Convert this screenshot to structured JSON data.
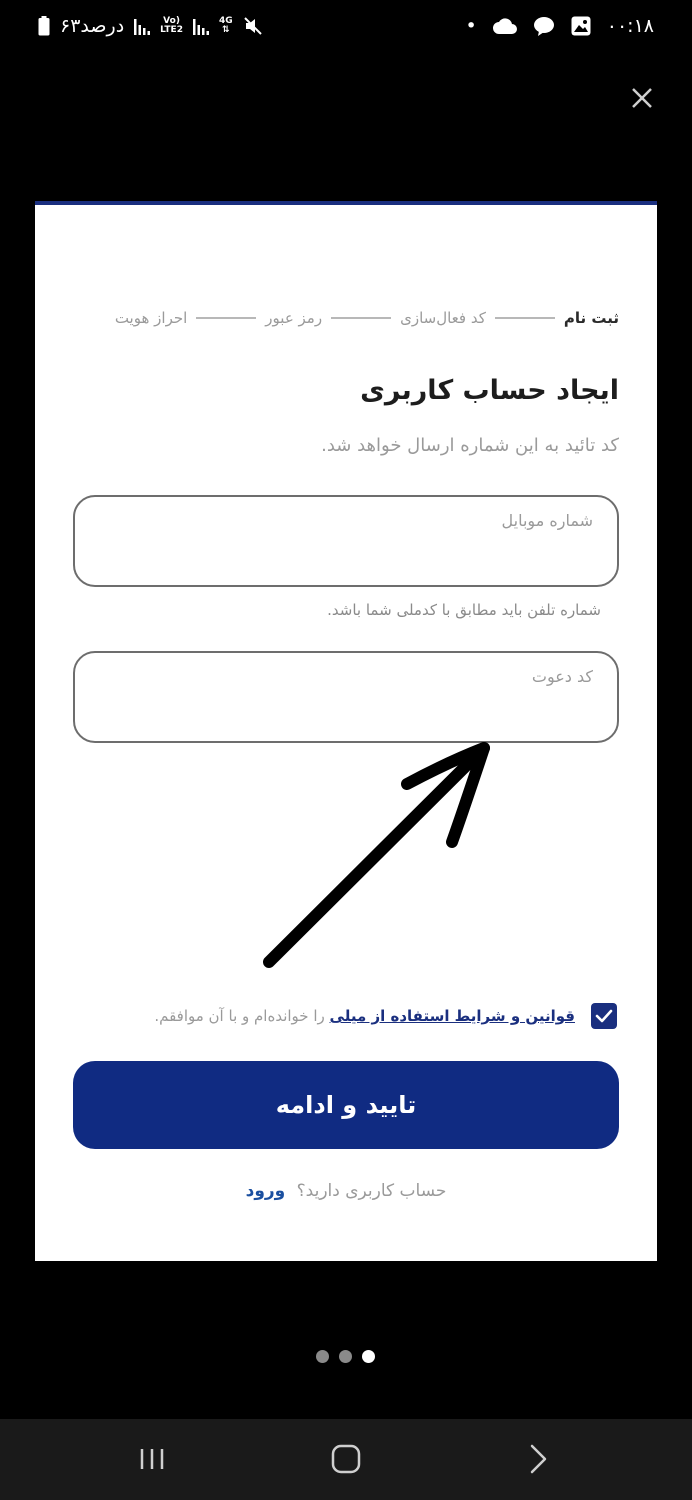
{
  "status_bar": {
    "time": "۰۰:۱۸",
    "battery_text": "۶۳درصد",
    "network_4g": "4G",
    "volte_top": "Vo)",
    "volte_bottom": "LTE2",
    "dot": "•"
  },
  "signup": {
    "steps": [
      "ثبت نام",
      "کد فعال‌سازی",
      "رمز عبور",
      "احراز هویت"
    ],
    "active_step_index": 0,
    "title": "ایجاد حساب کاربری",
    "subtitle": "کد تائید به این شماره ارسال خواهد شد.",
    "mobile_label": "شماره موبایل",
    "mobile_hint": "شماره تلفن باید مطابق با کدملی شما باشد.",
    "invite_label": "کد دعوت",
    "terms_link": "قوانین و شرایط استفاده از میلی",
    "terms_suffix": "را خوانده‌ام و با آن موافقم.",
    "terms_checked": true,
    "submit_label": "تایید و ادامه",
    "login_prompt": "حساب کاربری دارید؟",
    "login_link": "ورود"
  },
  "pager": {
    "count": 3,
    "active_index": 2
  },
  "colors": {
    "primary": "#102b82",
    "link": "#1a4fa0",
    "muted": "#9a9a9a"
  }
}
